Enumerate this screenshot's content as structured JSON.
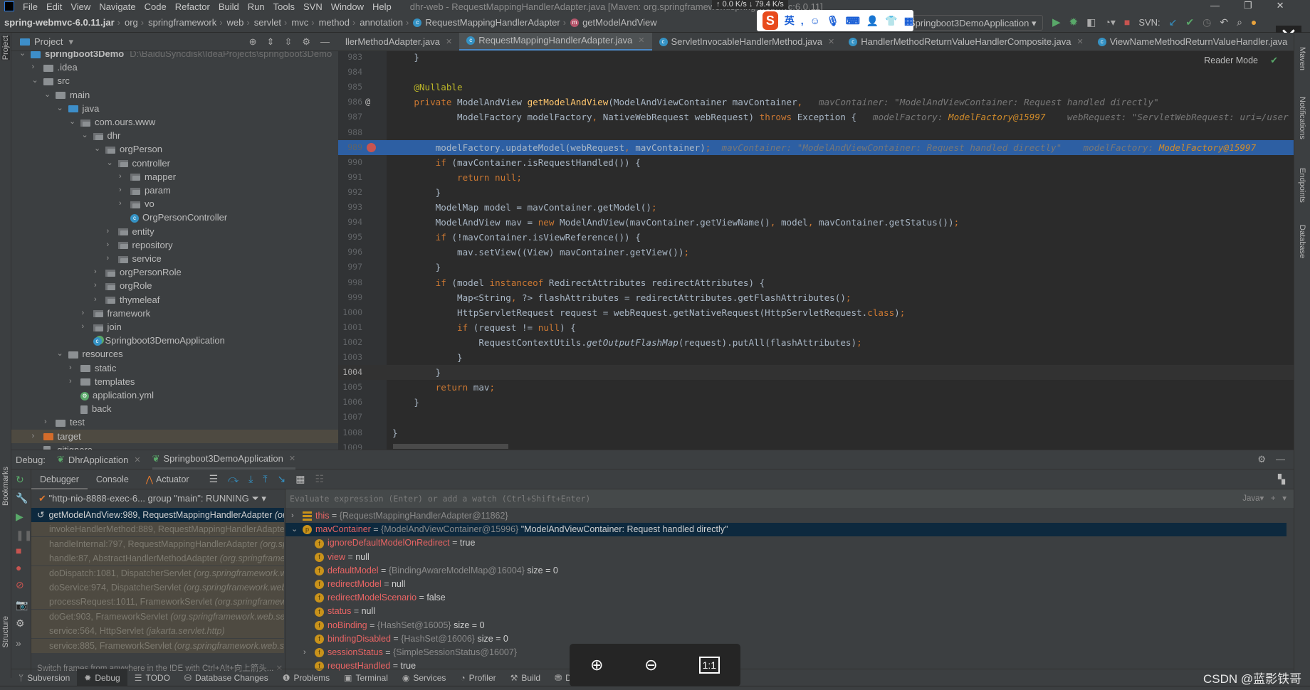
{
  "menubar": {
    "items": [
      "File",
      "Edit",
      "View",
      "Navigate",
      "Code",
      "Refactor",
      "Build",
      "Run",
      "Tools",
      "SVN",
      "Window",
      "Help"
    ],
    "title": "dhr-web - RequestMappingHandlerAdapter.java [Maven: org.springframework:spring-webmvc:6.0.11]"
  },
  "netspeed": {
    "up": "0.0 K/s",
    "down": "79.4 K/s"
  },
  "navbar": {
    "crumbs": [
      "spring-webmvc-6.0.11.jar",
      "org",
      "springframework",
      "web",
      "servlet",
      "mvc",
      "method",
      "annotation",
      "RequestMappingHandlerAdapter",
      "getModelAndView"
    ],
    "run_config": "Springboot3DemoApplication",
    "svn_label": "SVN:"
  },
  "ime": {
    "logo": "S",
    "lang": "英"
  },
  "project": {
    "header": "Project",
    "tree": [
      {
        "d": 0,
        "label": "springboot3Demo",
        "icon": "module",
        "exp": "open",
        "path": "D:\\BaiduSyncdisk\\IdeaProjects\\springboot3Demo"
      },
      {
        "d": 1,
        "label": ".idea",
        "icon": "folder",
        "exp": "closed"
      },
      {
        "d": 1,
        "label": "src",
        "icon": "folder",
        "exp": "open"
      },
      {
        "d": 2,
        "label": "main",
        "icon": "folder",
        "exp": "open"
      },
      {
        "d": 3,
        "label": "java",
        "icon": "source",
        "exp": "open"
      },
      {
        "d": 4,
        "label": "com.ours.www",
        "icon": "package",
        "exp": "open"
      },
      {
        "d": 5,
        "label": "dhr",
        "icon": "package",
        "exp": "open"
      },
      {
        "d": 6,
        "label": "orgPerson",
        "icon": "package",
        "exp": "open"
      },
      {
        "d": 7,
        "label": "controller",
        "icon": "package",
        "exp": "open"
      },
      {
        "d": 8,
        "label": "mapper",
        "icon": "package",
        "exp": "closed"
      },
      {
        "d": 8,
        "label": "param",
        "icon": "package",
        "exp": "closed"
      },
      {
        "d": 8,
        "label": "vo",
        "icon": "package",
        "exp": "closed"
      },
      {
        "d": 8,
        "label": "OrgPersonController",
        "icon": "class",
        "exp": "none"
      },
      {
        "d": 7,
        "label": "entity",
        "icon": "package",
        "exp": "closed"
      },
      {
        "d": 7,
        "label": "repository",
        "icon": "package",
        "exp": "closed"
      },
      {
        "d": 7,
        "label": "service",
        "icon": "package",
        "exp": "closed"
      },
      {
        "d": 6,
        "label": "orgPersonRole",
        "icon": "package",
        "exp": "closed"
      },
      {
        "d": 6,
        "label": "orgRole",
        "icon": "package",
        "exp": "closed"
      },
      {
        "d": 6,
        "label": "thymeleaf",
        "icon": "package",
        "exp": "closed"
      },
      {
        "d": 5,
        "label": "framework",
        "icon": "package",
        "exp": "closed"
      },
      {
        "d": 5,
        "label": "join",
        "icon": "package",
        "exp": "closed"
      },
      {
        "d": 5,
        "label": "Springboot3DemoApplication",
        "icon": "spring-class",
        "exp": "none"
      },
      {
        "d": 3,
        "label": "resources",
        "icon": "resources",
        "exp": "open"
      },
      {
        "d": 4,
        "label": "static",
        "icon": "folder",
        "exp": "closed"
      },
      {
        "d": 4,
        "label": "templates",
        "icon": "folder",
        "exp": "closed"
      },
      {
        "d": 4,
        "label": "application.yml",
        "icon": "yaml",
        "exp": "none"
      },
      {
        "d": 4,
        "label": "back",
        "icon": "file",
        "exp": "none"
      },
      {
        "d": 2,
        "label": "test",
        "icon": "folder",
        "exp": "closed"
      },
      {
        "d": 1,
        "label": "target",
        "icon": "excluded-folder",
        "exp": "closed",
        "selected": true
      },
      {
        "d": 1,
        "label": ".gitignore",
        "icon": "file",
        "exp": "none"
      }
    ]
  },
  "editor": {
    "tabs": [
      {
        "label": "llerMethodAdapter.java",
        "active": false
      },
      {
        "label": "RequestMappingHandlerAdapter.java",
        "active": true
      },
      {
        "label": "ServletInvocableHandlerMethod.java",
        "active": false
      },
      {
        "label": "HandlerMethodReturnValueHandlerComposite.java",
        "active": false
      },
      {
        "label": "ViewNameMethodReturnValueHandler.java",
        "active": false
      }
    ],
    "reader_mode": "Reader Mode",
    "exec_line": 989,
    "caret_line": 1004,
    "breakpoint_line": 989,
    "override_line": 986,
    "lines": [
      {
        "n": 983,
        "tok": [
          [
            "t",
            "    }"
          ]
        ]
      },
      {
        "n": 984,
        "tok": []
      },
      {
        "n": 985,
        "tok": [
          [
            "a",
            "    @Nullable"
          ]
        ]
      },
      {
        "n": 986,
        "tok": [
          [
            "k",
            "    private"
          ],
          [
            "t",
            " ModelAndView "
          ],
          [
            "f",
            "getModelAndView"
          ],
          [
            "t",
            "(ModelAndViewContainer mavContainer"
          ],
          [
            "k",
            ","
          ],
          [
            "h",
            "   mavContainer: \"ModelAndViewContainer: Request handled directly\""
          ]
        ]
      },
      {
        "n": 987,
        "tok": [
          [
            "t",
            "            ModelFactory modelFactory"
          ],
          [
            "k",
            ","
          ],
          [
            "t",
            " NativeWebRequest webRequest) "
          ],
          [
            "k",
            "throws"
          ],
          [
            "t",
            " Exception {"
          ],
          [
            "h",
            "   modelFactory: "
          ],
          [
            "o",
            "ModelFactory@15997"
          ],
          [
            "h",
            "    webRequest: \"ServletWebRequest: uri=/user"
          ]
        ]
      },
      {
        "n": 988,
        "tok": []
      },
      {
        "n": 989,
        "tok": [
          [
            "t",
            "        modelFactory.updateModel(webRequest"
          ],
          [
            "k",
            ","
          ],
          [
            "t",
            " mavContainer)"
          ],
          [
            "k",
            ";"
          ],
          [
            "h",
            "  mavContainer: \"ModelAndViewContainer: Request handled directly\"    modelFactory: "
          ],
          [
            "o",
            "ModelFactory@15997"
          ]
        ]
      },
      {
        "n": 990,
        "tok": [
          [
            "k",
            "        if"
          ],
          [
            "t",
            " (mavContainer.isRequestHandled()) {"
          ]
        ]
      },
      {
        "n": 991,
        "tok": [
          [
            "k",
            "            return null;"
          ]
        ]
      },
      {
        "n": 992,
        "tok": [
          [
            "t",
            "        }"
          ]
        ]
      },
      {
        "n": 993,
        "tok": [
          [
            "t",
            "        ModelMap model = mavContainer.getModel()"
          ],
          [
            "k",
            ";"
          ]
        ]
      },
      {
        "n": 994,
        "tok": [
          [
            "t",
            "        ModelAndView mav = "
          ],
          [
            "k",
            "new"
          ],
          [
            "t",
            " ModelAndView(mavContainer.getViewName()"
          ],
          [
            "k",
            ","
          ],
          [
            "t",
            " model"
          ],
          [
            "k",
            ","
          ],
          [
            "t",
            " mavContainer.getStatus())"
          ],
          [
            "k",
            ";"
          ]
        ]
      },
      {
        "n": 995,
        "tok": [
          [
            "k",
            "        if"
          ],
          [
            "t",
            " (!mavContainer.isViewReference()) {"
          ]
        ]
      },
      {
        "n": 996,
        "tok": [
          [
            "t",
            "            mav.setView((View) mavContainer.getView())"
          ],
          [
            "k",
            ";"
          ]
        ]
      },
      {
        "n": 997,
        "tok": [
          [
            "t",
            "        }"
          ]
        ]
      },
      {
        "n": 998,
        "tok": [
          [
            "k",
            "        if"
          ],
          [
            "t",
            " (model "
          ],
          [
            "k",
            "instanceof"
          ],
          [
            "t",
            " RedirectAttributes redirectAttributes) {"
          ]
        ]
      },
      {
        "n": 999,
        "tok": [
          [
            "t",
            "            Map<String"
          ],
          [
            "k",
            ","
          ],
          [
            "t",
            " ?> flashAttributes = redirectAttributes.getFlashAttributes()"
          ],
          [
            "k",
            ";"
          ]
        ]
      },
      {
        "n": 1000,
        "tok": [
          [
            "t",
            "            HttpServletRequest request = webRequest.getNativeRequest(HttpServletRequest."
          ],
          [
            "k",
            "class"
          ],
          [
            "t",
            ")"
          ],
          [
            "k",
            ";"
          ]
        ]
      },
      {
        "n": 1001,
        "tok": [
          [
            "k",
            "            if"
          ],
          [
            "t",
            " (request != "
          ],
          [
            "k",
            "null"
          ],
          [
            "t",
            ") {"
          ]
        ]
      },
      {
        "n": 1002,
        "tok": [
          [
            "t",
            "                RequestContextUtils."
          ],
          [
            "s",
            "getOutputFlashMap"
          ],
          [
            "t",
            "(request).putAll(flashAttributes)"
          ],
          [
            "k",
            ";"
          ]
        ]
      },
      {
        "n": 1003,
        "tok": [
          [
            "t",
            "            }"
          ]
        ]
      },
      {
        "n": 1004,
        "tok": [
          [
            "t",
            "        }"
          ]
        ]
      },
      {
        "n": 1005,
        "tok": [
          [
            "k",
            "        return"
          ],
          [
            "t",
            " mav"
          ],
          [
            "k",
            ";"
          ]
        ]
      },
      {
        "n": 1006,
        "tok": [
          [
            "t",
            "    }"
          ]
        ]
      },
      {
        "n": 1007,
        "tok": []
      },
      {
        "n": 1008,
        "tok": [
          [
            "t",
            "}"
          ]
        ]
      },
      {
        "n": 1009,
        "tok": []
      }
    ]
  },
  "stripes": {
    "left": [
      "Project",
      "Bookmarks",
      "Structure"
    ],
    "right": [
      "Maven",
      "Notifications",
      "Endpoints",
      "Database"
    ]
  },
  "debug": {
    "label": "Debug:",
    "sessions": [
      {
        "label": "DhrApplication",
        "active": false
      },
      {
        "label": "Springboot3DemoApplication",
        "active": true
      }
    ],
    "tabs": [
      "Debugger",
      "Console",
      "Actuator"
    ],
    "thread": "\"http-nio-8888-exec-6... group \"main\": RUNNING",
    "frames": [
      {
        "m": "getModelAndView:989, RequestMappingHandlerAdapter",
        "p": "(org.springframework.web.servlet.mvc.method.annotation)",
        "cur": true
      },
      {
        "m": "invokeHandlerMethod:889, RequestMappingHandlerAdapter",
        "p": "(org.springframework.web.servlet.mvc.method.annotation)"
      },
      {
        "m": "handleInternal:797, RequestMappingHandlerAdapter",
        "p": "(org.springframework.web.servlet.mvc.method.annotation)"
      },
      {
        "m": "handle:87, AbstractHandlerMethodAdapter",
        "p": "(org.springframework.web.servlet.mvc.method)"
      },
      {
        "m": "doDispatch:1081, DispatcherServlet",
        "p": "(org.springframework.web.servlet)"
      },
      {
        "m": "doService:974, DispatcherServlet",
        "p": "(org.springframework.web.servlet)"
      },
      {
        "m": "processRequest:1011, FrameworkServlet",
        "p": "(org.springframework.web.servlet)"
      },
      {
        "m": "doGet:903, FrameworkServlet",
        "p": "(org.springframework.web.servlet)"
      },
      {
        "m": "service:564, HttpServlet",
        "p": "(jakarta.servlet.http)"
      },
      {
        "m": "service:885, FrameworkServlet",
        "p": "(org.springframework.web.servlet)"
      }
    ],
    "switch_hint": "Switch frames from anywhere in the IDE with Ctrl+Alt+向上箭头...",
    "eval_placeholder": "Evaluate expression (Enter) or add a watch (Ctrl+Shift+Enter)",
    "lang": "Java",
    "variables": [
      {
        "d": 0,
        "exp": "closed",
        "icon": "bars",
        "name": "this",
        "type": "{RequestMappingHandlerAdapter@11862}",
        "val": ""
      },
      {
        "d": 0,
        "exp": "open",
        "icon": "p",
        "name": "mavContainer",
        "type": "{ModelAndViewContainer@15996}",
        "val": "\"ModelAndViewContainer: Request handled directly\"",
        "sel": true
      },
      {
        "d": 1,
        "exp": "none",
        "icon": "f",
        "name": "ignoreDefaultModelOnRedirect",
        "type": "",
        "val": "true"
      },
      {
        "d": 1,
        "exp": "none",
        "icon": "f",
        "name": "view",
        "type": "",
        "val": "null"
      },
      {
        "d": 1,
        "exp": "none",
        "icon": "f",
        "name": "defaultModel",
        "type": "{BindingAwareModelMap@16004}",
        "val": "size = 0"
      },
      {
        "d": 1,
        "exp": "none",
        "icon": "f",
        "name": "redirectModel",
        "type": "",
        "val": "null"
      },
      {
        "d": 1,
        "exp": "none",
        "icon": "f",
        "name": "redirectModelScenario",
        "type": "",
        "val": "false"
      },
      {
        "d": 1,
        "exp": "none",
        "icon": "f",
        "name": "status",
        "type": "",
        "val": "null"
      },
      {
        "d": 1,
        "exp": "none",
        "icon": "f",
        "name": "noBinding",
        "type": "{HashSet@16005}",
        "val": "size = 0"
      },
      {
        "d": 1,
        "exp": "none",
        "icon": "f",
        "name": "bindingDisabled",
        "type": "{HashSet@16006}",
        "val": "size = 0"
      },
      {
        "d": 1,
        "exp": "closed",
        "icon": "f",
        "name": "sessionStatus",
        "type": "{SimpleSessionStatus@16007}",
        "val": ""
      },
      {
        "d": 1,
        "exp": "none",
        "icon": "f",
        "name": "requestHandled",
        "type": "",
        "val": "true"
      }
    ]
  },
  "zoom_overlay": {
    "zoom_in": "⊕",
    "zoom_out": "⊖",
    "actual": "1:1"
  },
  "bottom_tools": [
    {
      "label": "Subversion",
      "icon": "ᛘ"
    },
    {
      "label": "Debug",
      "icon": "✹",
      "active": true
    },
    {
      "label": "TODO",
      "icon": "☰"
    },
    {
      "label": "Database Changes",
      "icon": "⛁"
    },
    {
      "label": "Problems",
      "icon": "❶"
    },
    {
      "label": "Terminal",
      "icon": "▣"
    },
    {
      "label": "Services",
      "icon": "◉"
    },
    {
      "label": "Profiler",
      "icon": "◔"
    },
    {
      "label": "Build",
      "icon": "⚒"
    },
    {
      "label": "Dependencies",
      "icon": "⛃"
    }
  ],
  "watermark": "CSDN @蓝影铁哥"
}
